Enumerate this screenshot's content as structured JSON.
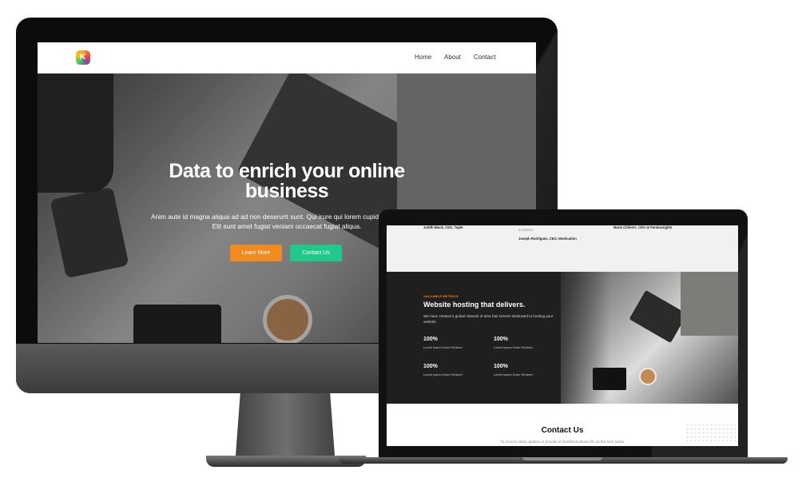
{
  "desktop": {
    "nav": {
      "links": [
        "Home",
        "About",
        "Contact"
      ],
      "logo_letter": "K"
    },
    "hero": {
      "title_line1": "Data to enrich your online",
      "title_line2": "business",
      "subtitle_line1": "Anim aute id magna aliqua ad ad non deserunt sunt. Qui irure qui lorem cupidatat commodo.",
      "subtitle_line2": "Elit sunt amet fugiat veniam occaecat fugiat aliqua.",
      "learn_more_label": "Learn More",
      "contact_label": "Contact Us"
    }
  },
  "laptop": {
    "testimonials": {
      "author1": "Judith Black, CEO, Tuple",
      "author2": "Joseph Rodriguez, CEO, Workcation",
      "author3": "Marie Chilvers, CEO at Pandaxsights",
      "fragment": "molestiae."
    },
    "metrics": {
      "eyebrow": "VALUABLE METRICS",
      "title": "Website hosting that delivers.",
      "description": "We have created a global network of ultra fast servers dedicated to hosting your website.",
      "stats": [
        {
          "value": "100%",
          "label": "Lorem Ipsum Dolor Sit Amet"
        },
        {
          "value": "100%",
          "label": "Lorem Ipsum Dolor Sit Amet"
        },
        {
          "value": "100%",
          "label": "Lorem Ipsum Dolor Sit Amet"
        },
        {
          "value": "100%",
          "label": "Lorem Ipsum Dolor Sit Amet"
        }
      ]
    },
    "contact": {
      "title": "Contact Us",
      "description": "To receive study updates or provide us feedback please fill out the form below"
    }
  },
  "colors": {
    "accent_orange": "#f28b1f",
    "accent_green": "#1ec98a",
    "dark_section": "#1f1f1f"
  }
}
